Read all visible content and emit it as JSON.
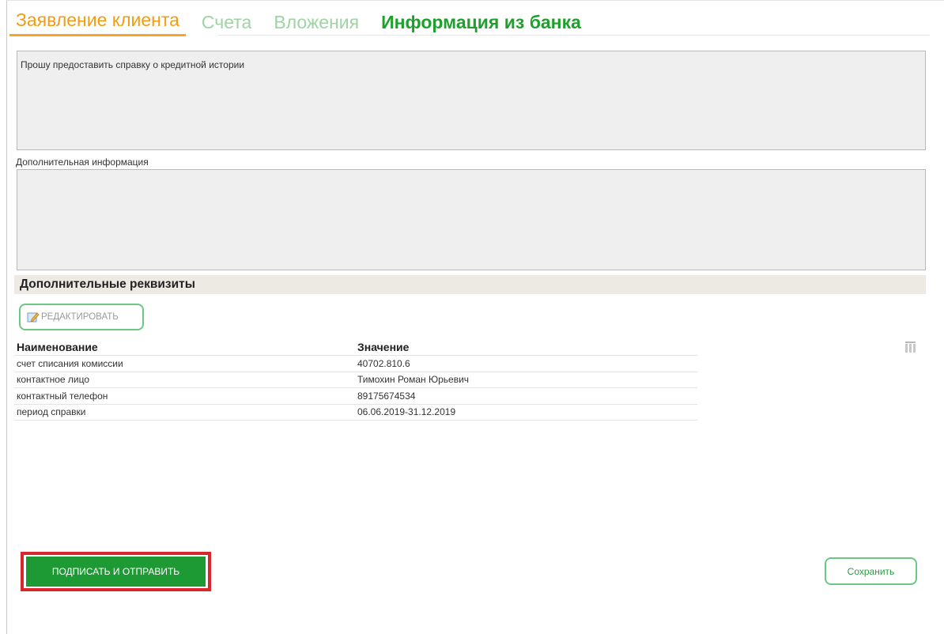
{
  "tabs": [
    {
      "label": "Заявление клиента"
    },
    {
      "label": "Счета"
    },
    {
      "label": "Вложения"
    },
    {
      "label": "Информация из банка"
    }
  ],
  "request_text": "Прошу предоставить справку о кредитной истории",
  "additional_info_label": "Дополнительная информация",
  "additional_info_text": "",
  "requisites": {
    "title": "Дополнительные реквизиты",
    "edit_label": "РЕДАКТИРОВАТЬ",
    "headers": [
      "Наименование",
      "Значение"
    ],
    "rows": [
      [
        "счет списания комиссии",
        "40702.810.6"
      ],
      [
        "контактное лицо",
        "Тимохин Роман Юрьевич"
      ],
      [
        "контактный телефон",
        "89175674534"
      ],
      [
        "период справки",
        "06.06.2019-31.12.2019"
      ]
    ]
  },
  "actions": {
    "sign_send": "ПОДПИСАТЬ И ОТПРАВИТЬ",
    "save": "Сохранить"
  },
  "colors": {
    "active_tab": "#f39c12",
    "inactive_tab": "#9fd3a4",
    "bank_tab": "#1fa02d",
    "primary_button": "#1d9a34",
    "highlight": "#d9262b"
  }
}
